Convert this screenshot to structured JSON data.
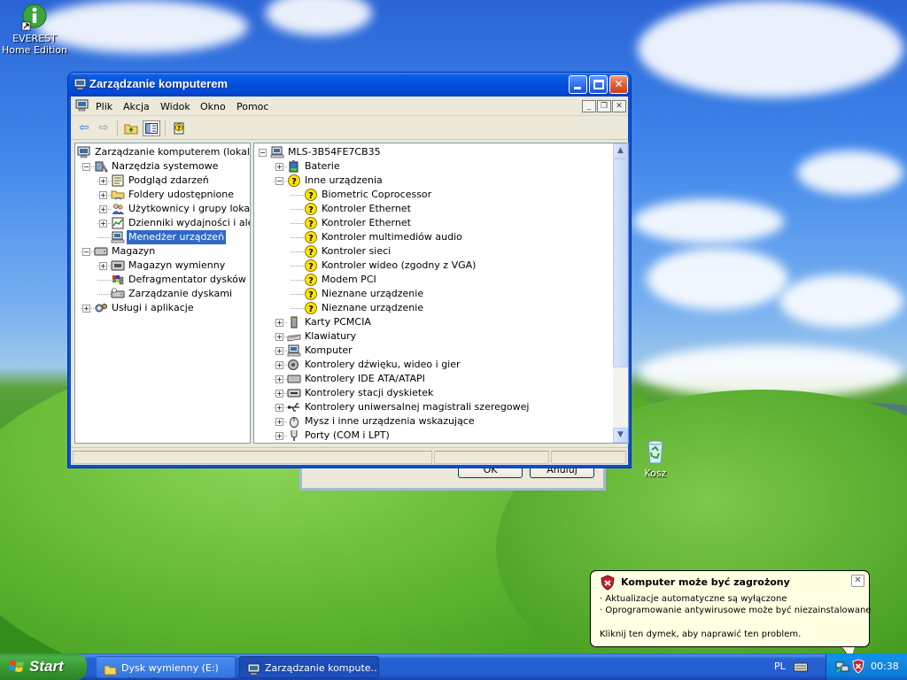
{
  "desktop": {
    "icons": [
      {
        "label": "EVEREST Home Edition"
      },
      {
        "label": "Kosz"
      }
    ]
  },
  "window": {
    "title": "Zarządzanie komputerem",
    "menu": [
      "Plik",
      "Akcja",
      "Widok",
      "Okno",
      "Pomoc"
    ],
    "left_tree": [
      {
        "label": "Zarządzanie komputerem (lokalne)",
        "level": 0,
        "expander": "",
        "icon": "computer-management-icon"
      },
      {
        "label": "Narzędzia systemowe",
        "level": 1,
        "expander": "−",
        "icon": "system-tools-icon"
      },
      {
        "label": "Podgląd zdarzeń",
        "level": 2,
        "expander": "+",
        "icon": "event-viewer-icon"
      },
      {
        "label": "Foldery udostępnione",
        "level": 2,
        "expander": "+",
        "icon": "shared-folder-icon"
      },
      {
        "label": "Użytkownicy i grupy lokalne",
        "level": 2,
        "expander": "+",
        "icon": "users-groups-icon"
      },
      {
        "label": "Dzienniki wydajności i alerty",
        "level": 2,
        "expander": "+",
        "icon": "performance-logs-icon"
      },
      {
        "label": "Menedżer urządzeń",
        "level": 2,
        "expander": "",
        "icon": "device-manager-icon",
        "selected": true
      },
      {
        "label": "Magazyn",
        "level": 1,
        "expander": "−",
        "icon": "storage-icon"
      },
      {
        "label": "Magazyn wymienny",
        "level": 2,
        "expander": "+",
        "icon": "removable-storage-icon"
      },
      {
        "label": "Defragmentator dysków",
        "level": 2,
        "expander": "",
        "icon": "defragmenter-icon"
      },
      {
        "label": "Zarządzanie dyskami",
        "level": 2,
        "expander": "",
        "icon": "disk-management-icon"
      },
      {
        "label": "Usługi i aplikacje",
        "level": 1,
        "expander": "+",
        "icon": "services-apps-icon"
      }
    ],
    "right_tree": [
      {
        "label": "MLS-3B54FE7CB35",
        "level": 0,
        "expander": "−",
        "icon": "computer-icon"
      },
      {
        "label": "Baterie",
        "level": 1,
        "expander": "+",
        "icon": "battery-icon"
      },
      {
        "label": "Inne urządzenia",
        "level": 1,
        "expander": "−",
        "icon": "unknown-device-icon"
      },
      {
        "label": "Biometric Coprocessor",
        "level": 2,
        "expander": "",
        "icon": "unknown-device-icon"
      },
      {
        "label": "Kontroler Ethernet",
        "level": 2,
        "expander": "",
        "icon": "unknown-device-icon"
      },
      {
        "label": "Kontroler Ethernet",
        "level": 2,
        "expander": "",
        "icon": "unknown-device-icon"
      },
      {
        "label": "Kontroler multimediów audio",
        "level": 2,
        "expander": "",
        "icon": "unknown-device-icon"
      },
      {
        "label": "Kontroler sieci",
        "level": 2,
        "expander": "",
        "icon": "unknown-device-icon"
      },
      {
        "label": "Kontroler wideo (zgodny z VGA)",
        "level": 2,
        "expander": "",
        "icon": "unknown-device-icon"
      },
      {
        "label": "Modem PCI",
        "level": 2,
        "expander": "",
        "icon": "unknown-device-icon"
      },
      {
        "label": "Nieznane urządzenie",
        "level": 2,
        "expander": "",
        "icon": "unknown-device-icon"
      },
      {
        "label": "Nieznane urządzenie",
        "level": 2,
        "expander": "",
        "icon": "unknown-device-icon"
      },
      {
        "label": "Karty PCMCIA",
        "level": 1,
        "expander": "+",
        "icon": "pcmcia-icon"
      },
      {
        "label": "Klawiatury",
        "level": 1,
        "expander": "+",
        "icon": "keyboard-icon"
      },
      {
        "label": "Komputer",
        "level": 1,
        "expander": "+",
        "icon": "computer-icon"
      },
      {
        "label": "Kontrolery dźwięku, wideo i gier",
        "level": 1,
        "expander": "+",
        "icon": "sound-icon"
      },
      {
        "label": "Kontrolery IDE ATA/ATAPI",
        "level": 1,
        "expander": "+",
        "icon": "ide-controller-icon"
      },
      {
        "label": "Kontrolery stacji dyskietek",
        "level": 1,
        "expander": "+",
        "icon": "floppy-controller-icon"
      },
      {
        "label": "Kontrolery uniwersalnej magistrali szeregowej",
        "level": 1,
        "expander": "+",
        "icon": "usb-icon"
      },
      {
        "label": "Mysz i inne urządzenia wskazujące",
        "level": 1,
        "expander": "+",
        "icon": "mouse-icon"
      },
      {
        "label": "Porty (COM i LPT)",
        "level": 1,
        "expander": "+",
        "icon": "port-icon"
      }
    ]
  },
  "dialog": {
    "ok_label": "OK",
    "cancel_label": "Anuluj"
  },
  "taskbar": {
    "start_label": "Start",
    "tasks": [
      {
        "label": "Dysk wymienny (E:)",
        "active": false
      },
      {
        "label": "Zarządzanie kompute...",
        "active": true
      }
    ],
    "language": "PL",
    "clock": "00:38"
  },
  "balloon": {
    "title": "Komputer może być zagrożony",
    "lines": [
      "· Aktualizacje automatyczne są wyłączone",
      "· Oprogramowanie antywirusowe może być niezainstalowane"
    ],
    "action": "Kliknij ten dymek, aby naprawić ten problem."
  },
  "colors": {
    "selection": "#316ac5",
    "titlebar": "#0450dc",
    "warning_yellow": "#ffe600",
    "balloon_bg": "#ffffe1"
  }
}
